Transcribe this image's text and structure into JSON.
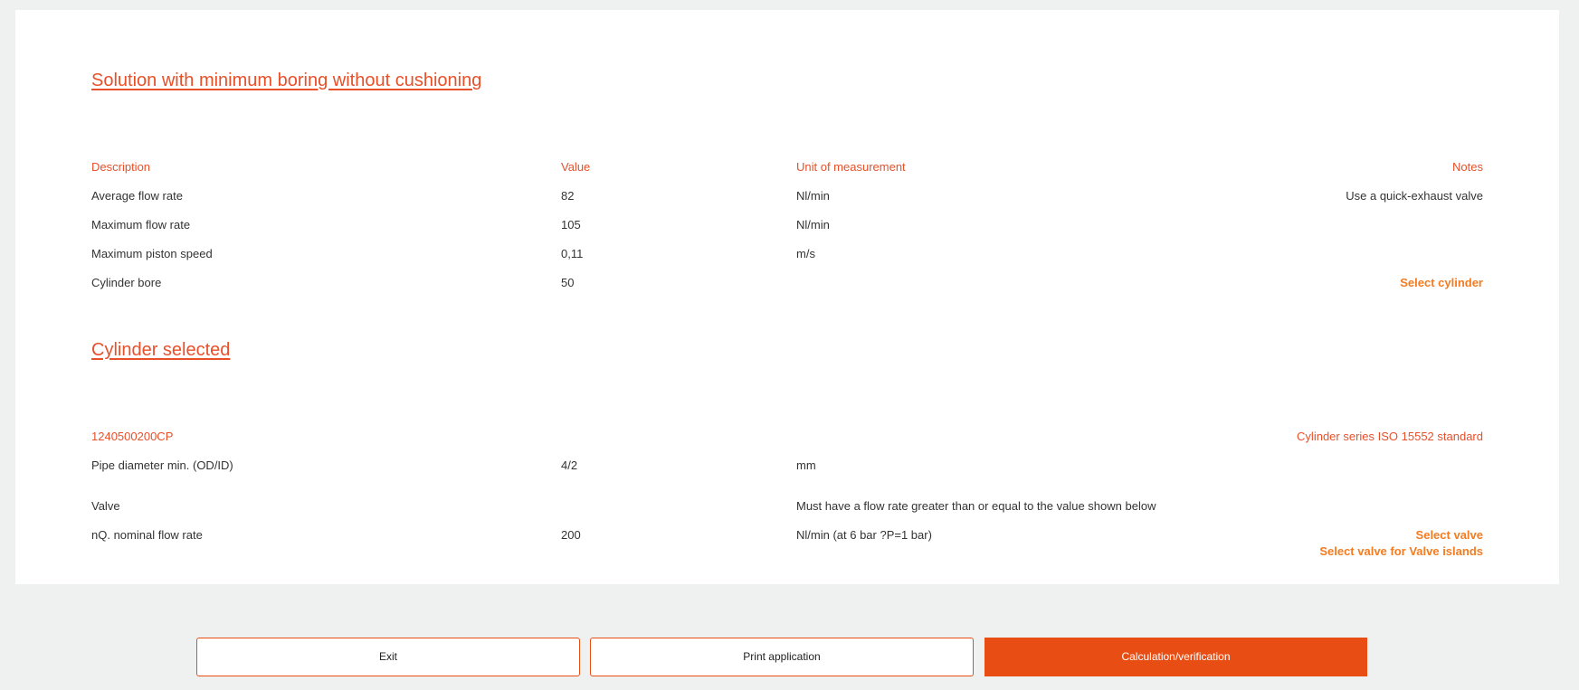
{
  "solution": {
    "title": "Solution with minimum boring without cushioning",
    "headers": {
      "description": "Description",
      "value": "Value",
      "unit": "Unit of measurement",
      "notes": "Notes"
    },
    "rows": [
      {
        "description": "Average flow rate",
        "value": "82",
        "unit": "Nl/min",
        "note": "Use a quick-exhaust valve"
      },
      {
        "description": "Maximum flow rate",
        "value": "105",
        "unit": "Nl/min",
        "note": ""
      },
      {
        "description": "Maximum piston speed",
        "value": "0,11",
        "unit": "m/s",
        "note": ""
      },
      {
        "description": "Cylinder bore",
        "value": "50",
        "unit": "",
        "link": "Select cylinder"
      }
    ]
  },
  "cylinder": {
    "title": "Cylinder selected",
    "part_number": "1240500200CP",
    "series": "Cylinder series ISO 15552 standard",
    "pipe": {
      "description": "Pipe diameter min. (OD/ID)",
      "value": "4/2",
      "unit": "mm"
    },
    "valve": {
      "description": "Valve",
      "note": "Must have a flow rate greater than or equal to the value shown below"
    },
    "nominal": {
      "description": "nQ. nominal flow rate",
      "value": "200",
      "unit": "Nl/min (at 6 bar ?P=1 bar)",
      "links": [
        "Select valve",
        "Select valve for Valve islands"
      ]
    }
  },
  "footer": {
    "exit_label": "Exit",
    "print_label": "Print application",
    "calc_label": "Calculation/verification"
  },
  "colors": {
    "accent": "#e8502a",
    "link": "#f47b20",
    "primary_button": "#e84e14",
    "background": "#eff0f0"
  }
}
